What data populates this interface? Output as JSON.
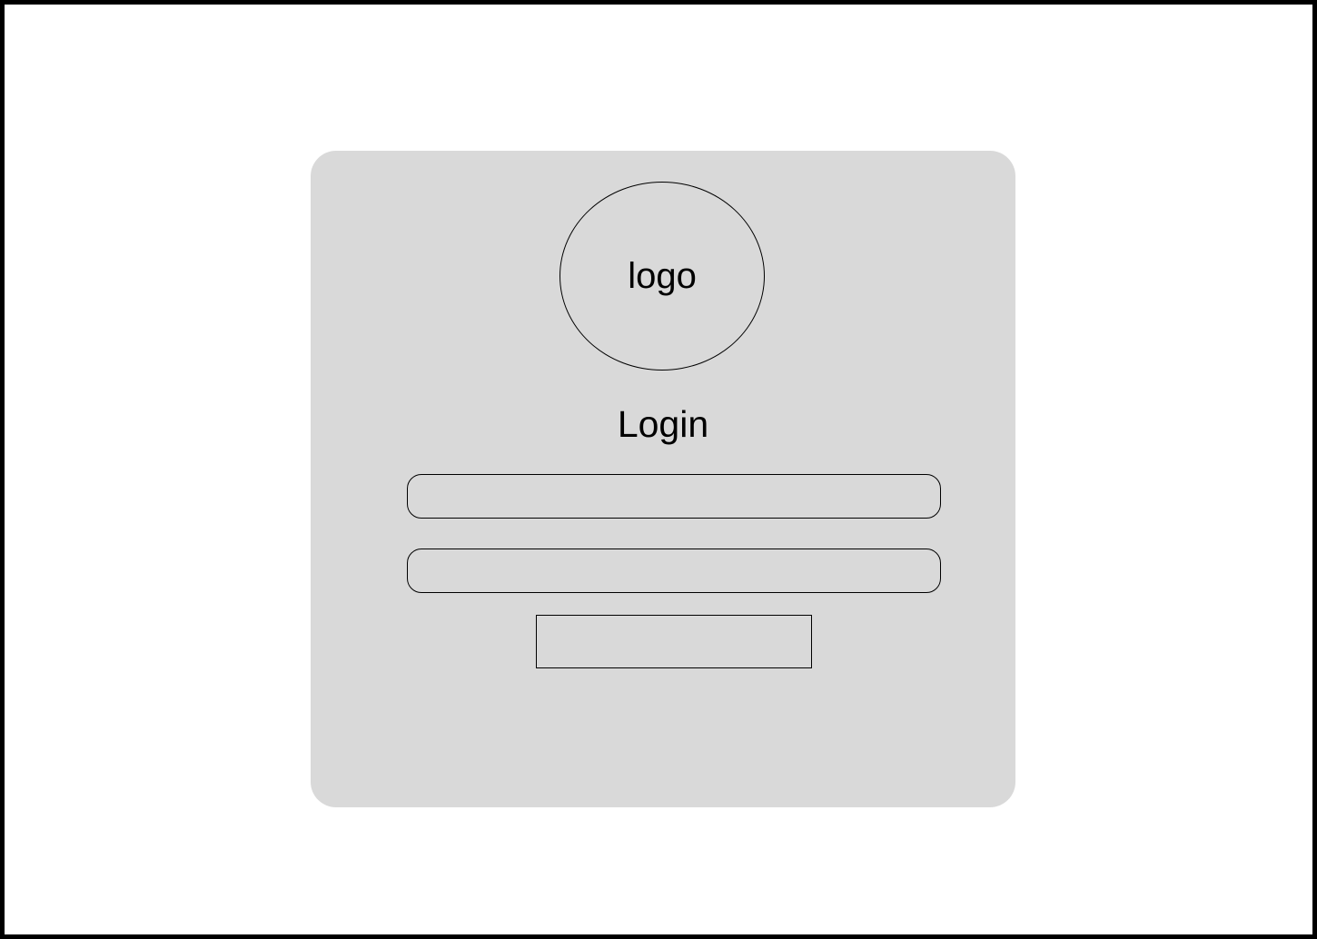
{
  "page": {
    "background": "#ffffff",
    "border_color": "#000000"
  },
  "card": {
    "background": "#d9d9d9",
    "logo": {
      "text": "logo"
    },
    "title": "Login",
    "username_field": {
      "value": "",
      "placeholder": ""
    },
    "password_field": {
      "value": "",
      "placeholder": ""
    },
    "submit_button": {
      "label": ""
    }
  }
}
